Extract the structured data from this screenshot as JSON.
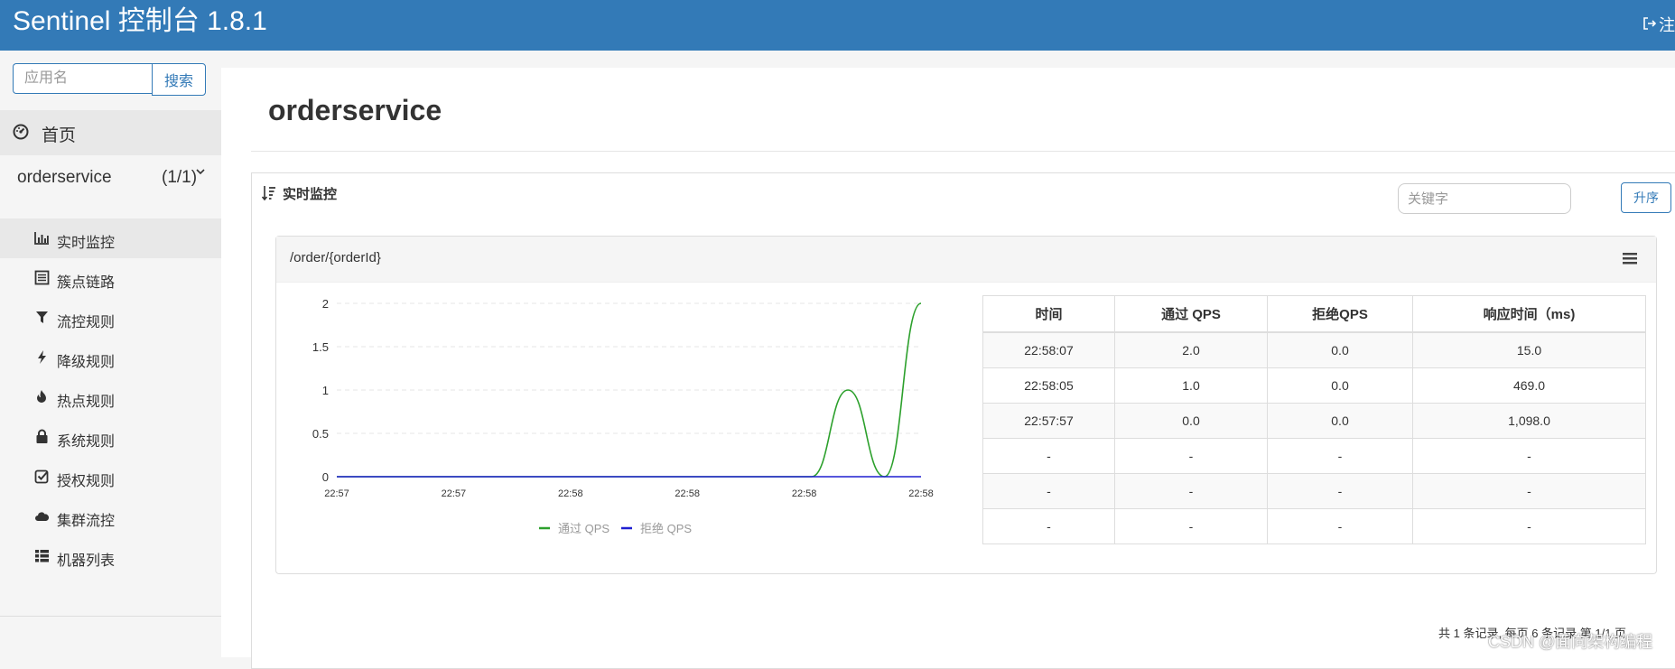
{
  "header": {
    "title": "Sentinel 控制台 1.8.1",
    "logout_label": "注"
  },
  "sidebar": {
    "search_placeholder": "应用名",
    "search_button": "搜索",
    "home_label": "首页",
    "app": {
      "name": "orderservice",
      "count": "(1/1)"
    },
    "items": [
      {
        "label": "实时监控",
        "icon": "bar-chart-icon",
        "active": true
      },
      {
        "label": "簇点链路",
        "icon": "list-alt-icon",
        "active": false
      },
      {
        "label": "流控规则",
        "icon": "filter-icon",
        "active": false
      },
      {
        "label": "降级规则",
        "icon": "flash-icon",
        "active": false
      },
      {
        "label": "热点规则",
        "icon": "fire-icon",
        "active": false
      },
      {
        "label": "系统规则",
        "icon": "lock-icon",
        "active": false
      },
      {
        "label": "授权规则",
        "icon": "check-icon",
        "active": false
      },
      {
        "label": "集群流控",
        "icon": "cloud-icon",
        "active": false
      },
      {
        "label": "机器列表",
        "icon": "th-list-icon",
        "active": false
      }
    ]
  },
  "main": {
    "page_title": "orderservice",
    "panel_title": "实时监控",
    "keyword_placeholder": "关键字",
    "sort_button": "升序",
    "resource": "/order/{orderId}",
    "table": {
      "headers": [
        "时间",
        "通过 QPS",
        "拒绝QPS",
        "响应时间（ms)"
      ],
      "rows": [
        [
          "22:58:07",
          "2.0",
          "0.0",
          "15.0"
        ],
        [
          "22:58:05",
          "1.0",
          "0.0",
          "469.0"
        ],
        [
          "22:57:57",
          "0.0",
          "0.0",
          "1,098.0"
        ],
        [
          "-",
          "-",
          "-",
          "-"
        ],
        [
          "-",
          "-",
          "-",
          "-"
        ],
        [
          "-",
          "-",
          "-",
          "-"
        ]
      ]
    },
    "pager_text": "共 1 条记录, 每页 6 条记录 第 1/1 页",
    "watermark": "CSDN @面向架构编程"
  },
  "colors": {
    "brand": "#337ab7",
    "pass_series": "#2ca02c",
    "block_series": "#1f1fd1"
  },
  "chart_data": {
    "type": "line",
    "x": [
      "22:57",
      "22:57",
      "22:58",
      "22:58",
      "22:58",
      "22:58"
    ],
    "yticks": [
      "0",
      "0.5",
      "1",
      "1.5",
      "2"
    ],
    "ylim": [
      0,
      2
    ],
    "grid": true,
    "legend_position": "bottom",
    "series": [
      {
        "name": "通过 QPS",
        "color": "#2ca02c",
        "values": [
          0,
          0,
          0,
          0,
          0,
          0,
          0,
          0,
          0,
          0,
          0,
          0,
          0,
          0,
          1,
          0,
          2
        ]
      },
      {
        "name": "拒绝 QPS",
        "color": "#1f1fd1",
        "values": [
          0,
          0,
          0,
          0,
          0,
          0,
          0,
          0,
          0,
          0,
          0,
          0,
          0,
          0,
          0,
          0,
          0
        ]
      }
    ]
  }
}
